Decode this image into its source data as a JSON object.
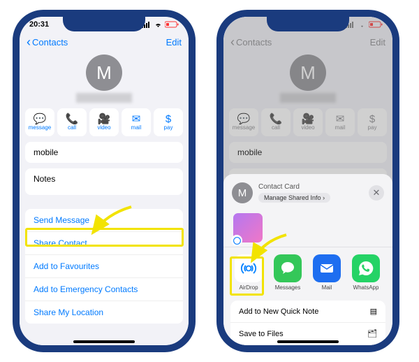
{
  "status": {
    "time": "20:31"
  },
  "nav": {
    "back": "Contacts",
    "edit": "Edit"
  },
  "avatar_letter": "M",
  "actions": [
    {
      "name": "message-button",
      "label": "message",
      "icon": "💬"
    },
    {
      "name": "call-button",
      "label": "call",
      "icon": "📞"
    },
    {
      "name": "video-button",
      "label": "video",
      "icon": "🎥"
    },
    {
      "name": "mail-button",
      "label": "mail",
      "icon": "✉"
    },
    {
      "name": "pay-button",
      "label": "pay",
      "icon": "$"
    }
  ],
  "fields": {
    "mobile": "mobile",
    "notes": "Notes"
  },
  "links": {
    "send": "Send Message",
    "share": "Share Contact",
    "fav": "Add to Favourites",
    "emerg": "Add to Emergency Contacts",
    "loc": "Share My Location"
  },
  "sheet": {
    "title": "Contact Card",
    "manage": "Manage Shared Info",
    "apps": [
      {
        "name": "airdrop-app",
        "label": "AirDrop",
        "cls": "airdrop"
      },
      {
        "name": "messages-app",
        "label": "Messages",
        "cls": "messages"
      },
      {
        "name": "mail-app",
        "label": "Mail",
        "cls": "mail"
      },
      {
        "name": "whatsapp-app",
        "label": "WhatsApp",
        "cls": "whatsapp"
      }
    ],
    "menu": [
      {
        "name": "quick-note",
        "label": "Add to New Quick Note",
        "icon": "▤"
      },
      {
        "name": "save-files",
        "label": "Save to Files",
        "icon": "🗂"
      }
    ]
  }
}
